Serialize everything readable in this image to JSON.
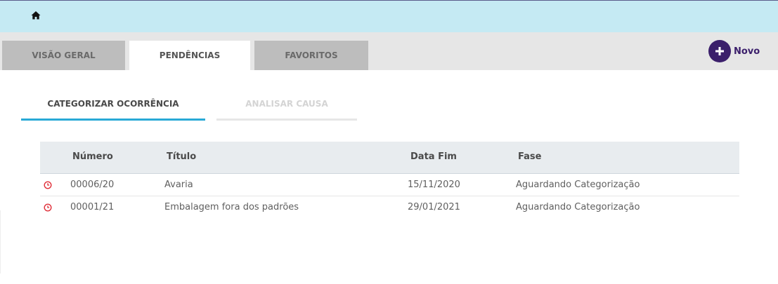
{
  "header": {
    "home_icon": "home-icon"
  },
  "tabs": [
    {
      "label": "VISÃO GERAL",
      "active": false
    },
    {
      "label": "PENDÊNCIAS",
      "active": true
    },
    {
      "label": "FAVORITOS",
      "active": false
    }
  ],
  "new_button": {
    "label": "Novo",
    "icon": "plus-icon",
    "color": "#3b1f6b"
  },
  "subtabs": [
    {
      "label": "CATEGORIZAR OCORRÊNCIA",
      "active": true
    },
    {
      "label": "ANALISAR CAUSA",
      "active": false
    }
  ],
  "table": {
    "columns": [
      "Número",
      "Título",
      "Data Fim",
      "Fase"
    ],
    "rows": [
      {
        "status_icon": "clock-icon",
        "numero": "00006/20",
        "titulo": "Avaria",
        "data_fim": "15/11/2020",
        "fase": "Aguardando Categorização"
      },
      {
        "status_icon": "clock-icon",
        "numero": "00001/21",
        "titulo": "Embalagem fora dos padrões",
        "data_fim": "29/01/2021",
        "fase": "Aguardando Categorização"
      }
    ]
  },
  "colors": {
    "topbar": "#c5eaf3",
    "accent": "#29a9d6",
    "status_icon": "#e0303a"
  }
}
